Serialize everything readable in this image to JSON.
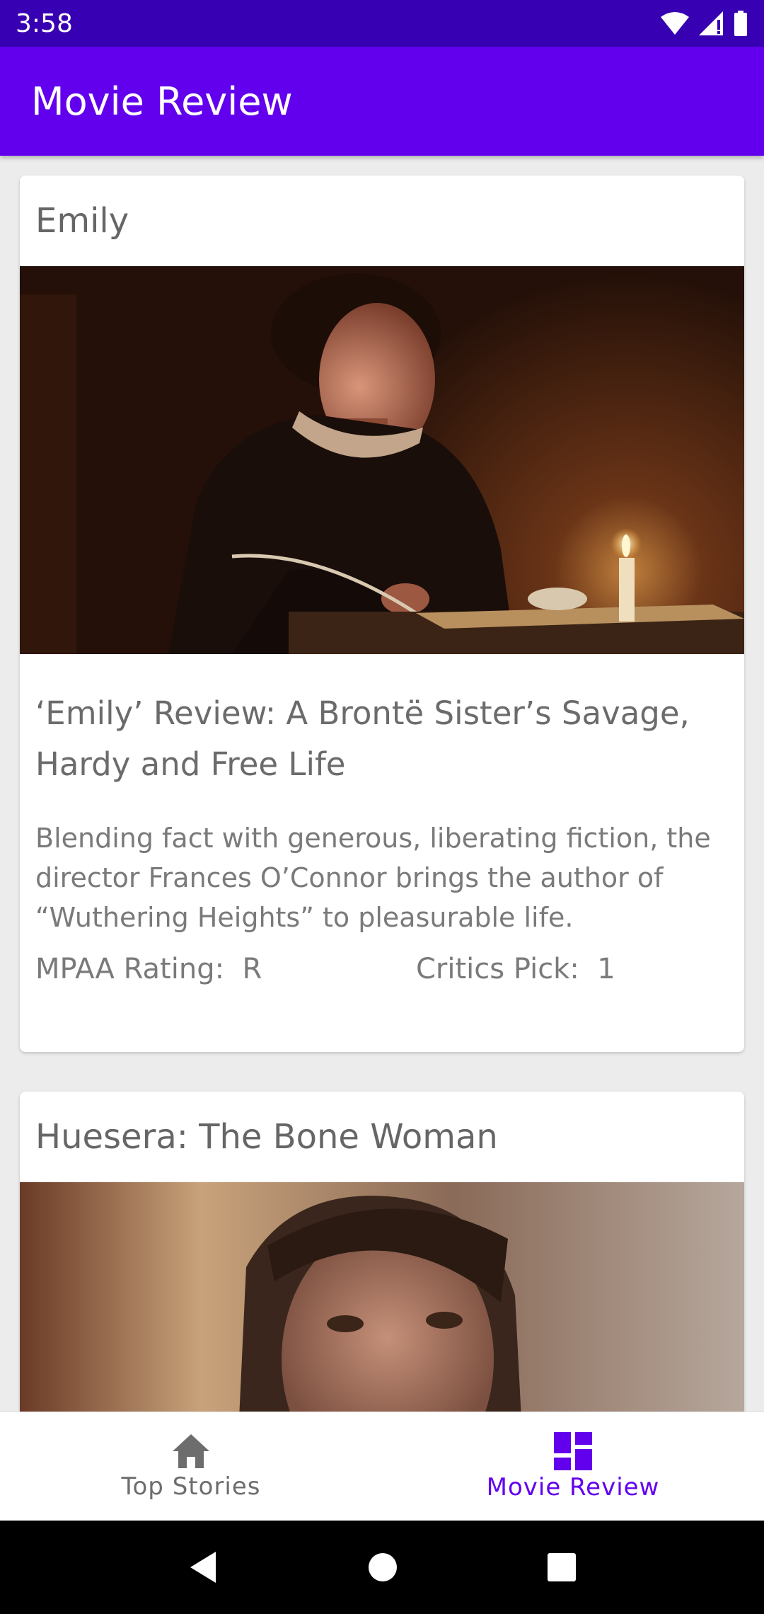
{
  "status_bar": {
    "time": "3:58",
    "icons": [
      "wifi-icon",
      "signal-icon",
      "battery-icon"
    ]
  },
  "app_bar": {
    "title": "Movie Review"
  },
  "reviews": [
    {
      "title": "Emily",
      "headline": "‘Emily’ Review: A Brontë Sister’s Savage, Hardy and Free Life",
      "summary": "Blending fact with generous, liberating fiction, the director Frances O’Connor brings the author of “Wuthering Heights” to pleasurable life.",
      "mpaa_label": "MPAA Rating:",
      "mpaa_value": "R",
      "critics_label": "Critics Pick:",
      "critics_value": "1"
    },
    {
      "title": "Huesera: The Bone Woman"
    }
  ],
  "bottom_nav": {
    "items": [
      {
        "label": "Top Stories",
        "icon": "home-icon",
        "active": false
      },
      {
        "label": "Movie Review",
        "icon": "dashboard-icon",
        "active": true
      }
    ]
  },
  "colors": {
    "status_bar": "#3700b3",
    "app_bar": "#6200ee",
    "accent": "#6200ee"
  }
}
